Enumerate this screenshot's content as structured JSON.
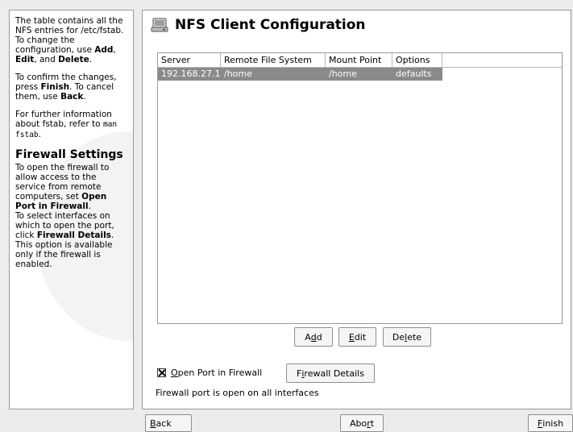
{
  "help": {
    "p1_a": "The table contains all the NFS entries for /etc/fstab. To change the configuration, use ",
    "p1_add": "Add",
    "p1_b": ", ",
    "p1_edit": "Edit",
    "p1_c": ", and ",
    "p1_delete": "Delete",
    "p1_d": ".",
    "p2_a": "To confirm the changes, press ",
    "p2_finish": "Finish",
    "p2_b": ". To cancel them, use ",
    "p2_back": "Back",
    "p2_c": ".",
    "p3_a": "For further information about fstab, refer to ",
    "p3_cmd": "man fstab",
    "p3_b": ".",
    "firewall_heading": "Firewall Settings",
    "p4_a": "To open the firewall to allow access to the service from remote computers, set ",
    "p4_open": "Open Port in Firewall",
    "p4_b": ".",
    "p5_a": "To select interfaces on which to open the port, click ",
    "p5_details": "Firewall Details",
    "p5_b": ". This option is available only if the firewall is enabled."
  },
  "main": {
    "title": "NFS Client Configuration",
    "title_icon": "hard-drive-icon",
    "table": {
      "columns": [
        "Server",
        "Remote File System",
        "Mount Point",
        "Options"
      ],
      "rows": [
        {
          "server": "192.168.27.1",
          "remote": "/home",
          "mount": "/home",
          "options": "defaults",
          "selected": true
        }
      ]
    },
    "buttons": {
      "add_pre": "A",
      "add_mn": "d",
      "add_post": "d",
      "edit_pre": "",
      "edit_mn": "E",
      "edit_post": "dit",
      "delete_pre": "De",
      "delete_mn": "l",
      "delete_post": "ete"
    },
    "firewall": {
      "open_port_mn": "O",
      "open_port_rest": "pen Port in Firewall",
      "open_port_checked": true,
      "details_pre": "F",
      "details_mn": "i",
      "details_post": "rewall Details",
      "status": "Firewall port is open on all interfaces"
    }
  },
  "footer": {
    "back_mn": "B",
    "back_rest": "ack",
    "abort_pre": "Abo",
    "abort_mn": "r",
    "abort_post": "t",
    "finish_mn": "F",
    "finish_rest": "inish"
  }
}
